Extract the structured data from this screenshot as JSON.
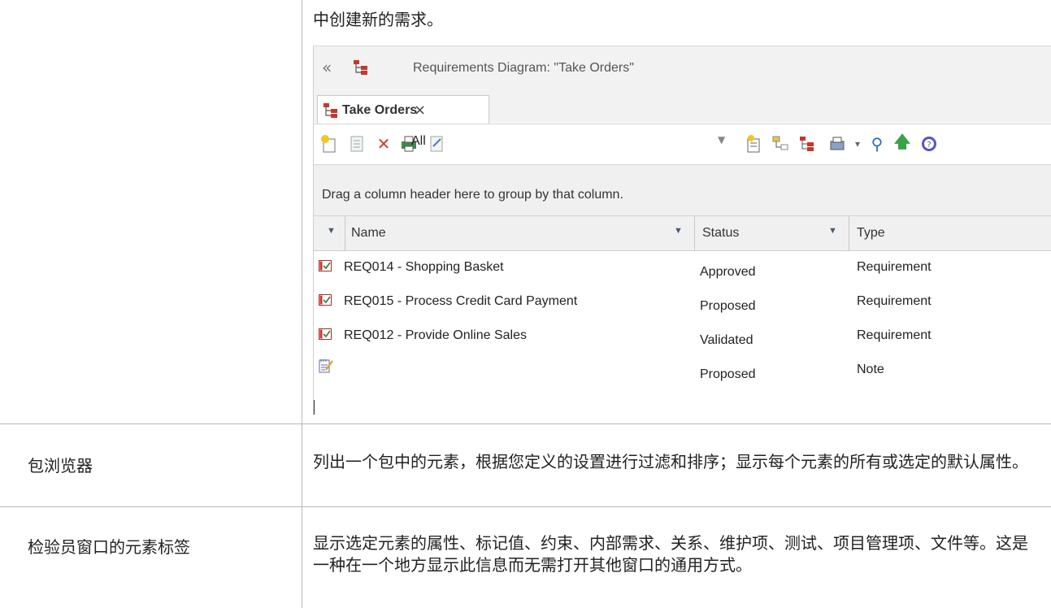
{
  "intro_text": "中创建新的需求。",
  "window": {
    "title": "Requirements Diagram: \"Take Orders\"",
    "tab_label": "Take Orders",
    "tab_close": "×",
    "filter_value": "All",
    "group_hint": "Drag a column header here to group by that column.",
    "columns": [
      "Name",
      "Status",
      "Type"
    ],
    "rows": [
      {
        "name": "REQ014 - Shopping Basket",
        "status": "Approved",
        "type": "Requirement",
        "icon": "requirement-icon"
      },
      {
        "name": "REQ015 - Process Credit Card Payment",
        "status": "Proposed",
        "type": "Requirement",
        "icon": "requirement-icon"
      },
      {
        "name": "REQ012 - Provide Online Sales",
        "status": "Validated",
        "type": "Requirement",
        "icon": "requirement-icon"
      },
      {
        "name": "",
        "status": "Proposed",
        "type": "Note",
        "icon": "note-icon"
      }
    ],
    "toolbar_icons": [
      "new-element-icon",
      "properties-icon",
      "delete-icon",
      "print-icon",
      "document-icon",
      "filter-dropdown-icon",
      "settings-icon",
      "view-hierarchy-icon",
      "diagram-icon",
      "options-icon",
      "search-icon",
      "up-arrow-icon",
      "help-icon"
    ]
  },
  "table": [
    {
      "label": "包浏览器",
      "desc": "列出一个包中的元素，根据您定义的设置进行过滤和排序；显示每个元素的所有或选定的默认属性。"
    },
    {
      "label": "检验员窗口的元素标签",
      "desc": "显示选定元素的属性、标记值、约束、内部需求、关系、维护项、测试、项目管理项、文件等。这是一种在一个地方显示此信息而无需打开其他窗口的通用方式。"
    }
  ]
}
